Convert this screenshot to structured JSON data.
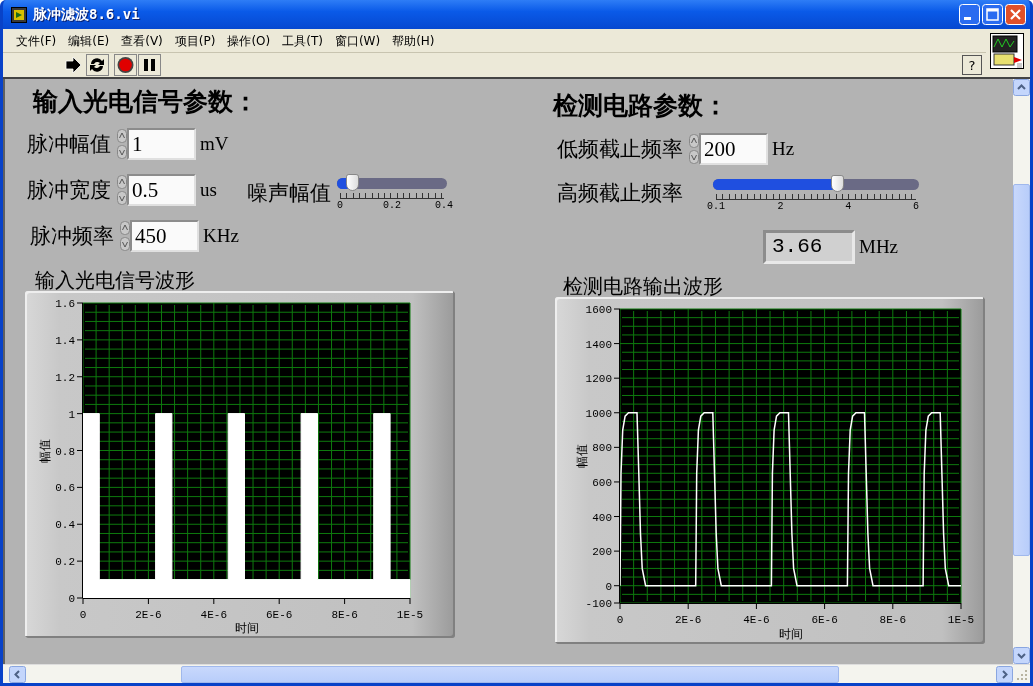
{
  "window": {
    "title": "脉冲滤波8.6.vi"
  },
  "menu": [
    "文件(F)",
    "编辑(E)",
    "查看(V)",
    "项目(P)",
    "操作(O)",
    "工具(T)",
    "窗口(W)",
    "帮助(H)"
  ],
  "toolbar": [
    {
      "kind": "run"
    },
    {
      "kind": "run-continuous"
    },
    {
      "kind": "abort"
    },
    {
      "kind": "pause"
    }
  ],
  "help_button": "?",
  "left_panel": {
    "heading": "输入光电信号参数：",
    "controls": [
      {
        "kind": "numeric",
        "label": "脉冲幅值",
        "value": "1",
        "unit": "mV"
      },
      {
        "kind": "numeric",
        "label": "脉冲宽度",
        "value": "0.5",
        "unit": "us"
      },
      {
        "kind": "numeric",
        "label": "脉冲频率",
        "value": "450",
        "unit": "KHz"
      }
    ],
    "noise_slider": {
      "label": "噪声幅值",
      "level": 0.14,
      "ticks": [
        "0",
        "0.2",
        "0.4"
      ]
    },
    "graph": {
      "title": "输入光电信号波形",
      "chart_data": {
        "type": "area",
        "xlabel": "时间",
        "ylabel": "幅值",
        "xlim": [
          0,
          1e-05
        ],
        "ylim": [
          0,
          1.6
        ],
        "yticks": [
          0,
          0.2,
          0.4,
          0.6,
          0.8,
          1,
          1.2,
          1.4,
          1.6
        ],
        "xticks": [
          {
            "value": 0,
            "label": "0"
          },
          {
            "value": 2e-06,
            "label": "2E-6"
          },
          {
            "value": 4e-06,
            "label": "4E-6"
          },
          {
            "value": 6e-06,
            "label": "6E-6"
          },
          {
            "value": 8e-06,
            "label": "8E-6"
          },
          {
            "value": 1e-05,
            "label": "1E-5"
          }
        ],
        "x": [
          0,
          5e-07,
          5e-07,
          2.22e-06,
          2.22e-06,
          2.72e-06,
          2.72e-06,
          4.44e-06,
          4.44e-06,
          4.94e-06,
          4.94e-06,
          6.67e-06,
          6.67e-06,
          7.17e-06,
          7.17e-06,
          8.89e-06,
          8.89e-06,
          9.39e-06,
          9.39e-06,
          1e-05
        ],
        "grid": true,
        "series": [
          {
            "color": "#ffffff",
            "values": [
              1,
              1,
              0.1,
              0.1,
              1,
              1,
              0.1,
              0.1,
              1,
              1,
              0.1,
              0.1,
              1,
              1,
              0.1,
              0.1,
              1,
              1,
              0.1,
              0.1
            ]
          }
        ]
      }
    }
  },
  "right_panel": {
    "heading": "检测电路参数：",
    "controls": [
      {
        "kind": "numeric",
        "label": "低频截止频率",
        "value": "200",
        "unit": "Hz"
      },
      {
        "kind": "slider",
        "label": "高频截止频率",
        "level": 0.6,
        "ticks": [
          "0.1",
          "2",
          "4",
          "6"
        ]
      },
      {
        "kind": "indicator",
        "value": "3.66",
        "unit": "MHz"
      }
    ],
    "graph": {
      "title": "检测电路输出波形",
      "chart_data": {
        "type": "line",
        "xlabel": "时间",
        "ylabel": "幅值",
        "xlim": [
          0,
          1e-05
        ],
        "ylim": [
          -100,
          1600
        ],
        "yticks": [
          -100,
          0,
          200,
          400,
          600,
          800,
          1000,
          1200,
          1400,
          1600
        ],
        "xticks": [
          {
            "value": 0,
            "label": "0"
          },
          {
            "value": 2e-06,
            "label": "2E-6"
          },
          {
            "value": 4e-06,
            "label": "4E-6"
          },
          {
            "value": 6e-06,
            "label": "6E-6"
          },
          {
            "value": 8e-06,
            "label": "8E-6"
          },
          {
            "value": 1e-05,
            "label": "1E-5"
          }
        ],
        "x": [
          0,
          3e-08,
          8e-08,
          1.5e-07,
          2.5e-07,
          5e-07,
          5.5e-07,
          6e-07,
          6.5e-07,
          7.5e-07,
          2.22e-06,
          2.25e-06,
          2.3e-06,
          2.37e-06,
          2.47e-06,
          2.72e-06,
          2.77e-06,
          2.82e-06,
          2.87e-06,
          2.97e-06,
          4.44e-06,
          4.47e-06,
          4.52e-06,
          4.59e-06,
          4.69e-06,
          4.94e-06,
          4.99e-06,
          5.04e-06,
          5.09e-06,
          5.19e-06,
          6.67e-06,
          6.7e-06,
          6.75e-06,
          6.82e-06,
          6.92e-06,
          7.17e-06,
          7.22e-06,
          7.27e-06,
          7.32e-06,
          7.42e-06,
          8.89e-06,
          8.92e-06,
          8.97e-06,
          9.04e-06,
          9.14e-06,
          9.39e-06,
          9.44e-06,
          9.49e-06,
          9.54e-06,
          9.64e-06,
          1e-05
        ],
        "grid": true,
        "series": [
          {
            "color": "#ffffff",
            "values": [
              0,
              650,
              900,
              980,
              1000,
              1000,
              650,
              300,
              100,
              0,
              0,
              650,
              900,
              980,
              1000,
              1000,
              650,
              300,
              100,
              0,
              0,
              650,
              900,
              980,
              1000,
              1000,
              650,
              300,
              100,
              0,
              0,
              650,
              900,
              980,
              1000,
              1000,
              650,
              300,
              100,
              0,
              0,
              650,
              900,
              980,
              1000,
              1000,
              650,
              300,
              100,
              0,
              0
            ]
          }
        ]
      }
    }
  }
}
